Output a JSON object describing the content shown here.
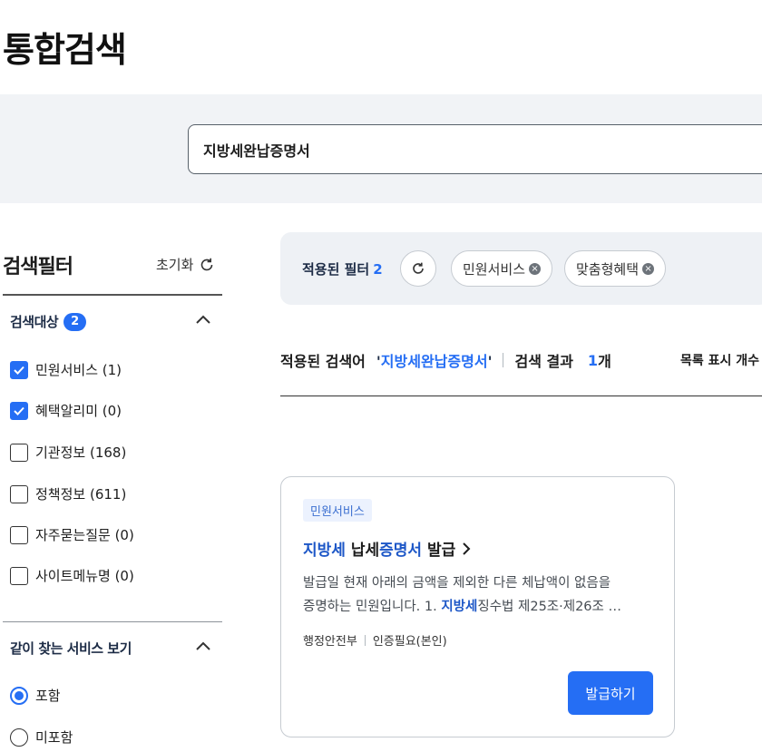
{
  "page": {
    "title": "통합검색"
  },
  "search": {
    "value": "지방세완납증명서"
  },
  "filter": {
    "title": "검색필터",
    "reset_label": "초기화",
    "target_group": {
      "label": "검색대상",
      "badge": "2",
      "items": [
        {
          "label": "민원서비스 (1)",
          "checked": true
        },
        {
          "label": "혜택알리미 (0)",
          "checked": true
        },
        {
          "label": "기관정보 (168)",
          "checked": false
        },
        {
          "label": "정책정보 (611)",
          "checked": false
        },
        {
          "label": "자주묻는질문 (0)",
          "checked": false
        },
        {
          "label": "사이트메뉴명 (0)",
          "checked": false
        }
      ]
    },
    "together_group": {
      "label": "같이 찾는 서비스 보기",
      "options": [
        {
          "label": "포함",
          "selected": true
        },
        {
          "label": "미포함",
          "selected": false
        }
      ]
    }
  },
  "applied": {
    "label": "적용된 필터",
    "count": "2",
    "chips": [
      "민원서비스",
      "맞춤형혜택"
    ]
  },
  "results_meta": {
    "query_label": "적용된 검색어",
    "query_open": "'",
    "query_text": "지방세완납증명서",
    "query_close": "'",
    "result_label": "검색 결과",
    "count": "1",
    "count_unit": "개",
    "list_display_label": "목록 표시 개수"
  },
  "card": {
    "tag": "민원서비스",
    "title_parts": {
      "hl1": "지방세",
      "plain1": " 납세",
      "hl2": "증명서",
      "plain2": " 발급"
    },
    "desc_line1": "발급일 현재 아래의 금액을 제외한 다른 체납액이 없음을",
    "desc_line2_before": "증명하는 민원입니다. 1. ",
    "desc_line2_hl": "지방세",
    "desc_line2_after": "징수법 제25조·제26조 …",
    "agency": "행정안전부",
    "auth": "인증필요(본인)",
    "button": "발급하기"
  },
  "colors": {
    "accent": "#256ef4",
    "band": "#f1f3f6",
    "tag_bg": "#ecf2fe"
  }
}
